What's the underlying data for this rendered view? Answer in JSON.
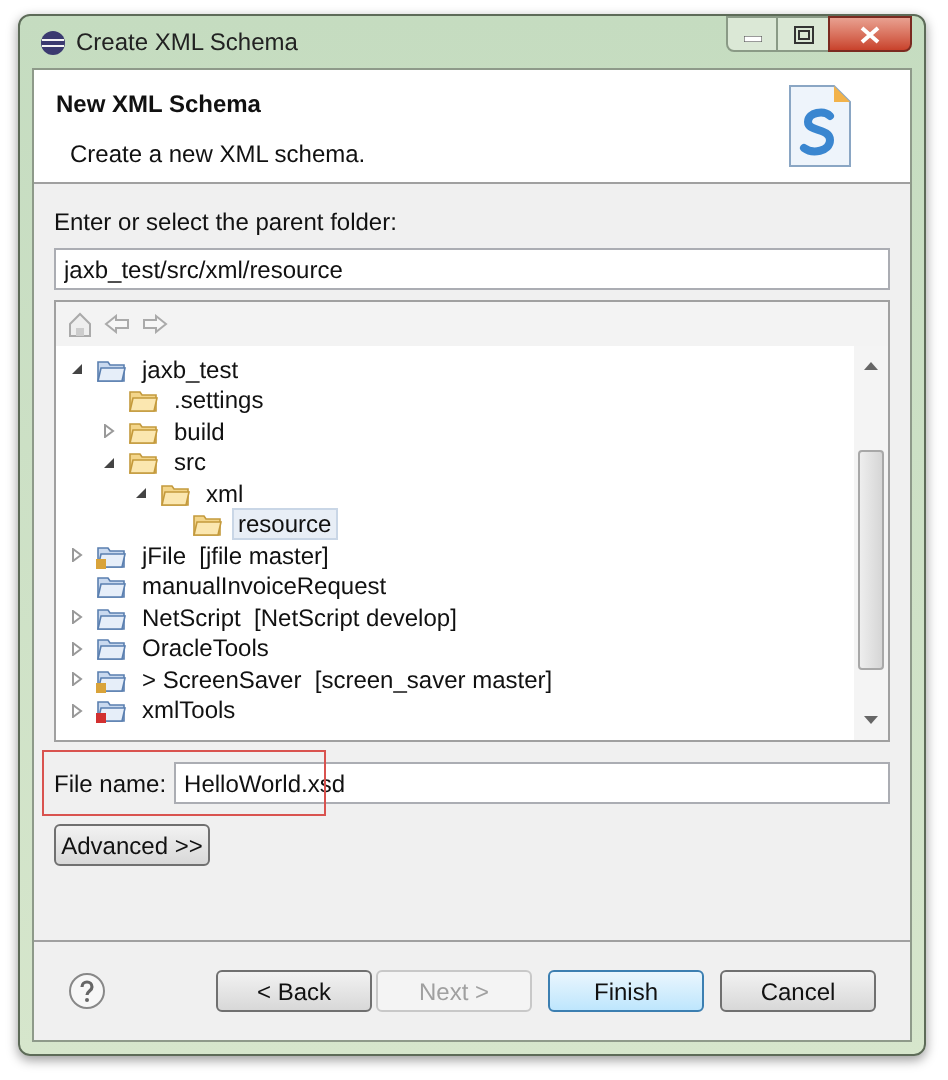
{
  "window": {
    "title": "Create XML Schema"
  },
  "header": {
    "title": "New XML Schema",
    "description": "Create a new XML schema."
  },
  "parent_folder": {
    "label": "Enter or select the parent folder:",
    "value": "jaxb_test/src/xml/resource"
  },
  "tree": [
    {
      "label": "jaxb_test",
      "kind": "project",
      "expanded": true,
      "selected": false,
      "children": [
        {
          "label": ".settings",
          "kind": "folder",
          "selected": false
        },
        {
          "label": "build",
          "kind": "folder",
          "expanded": false,
          "selected": false
        },
        {
          "label": "src",
          "kind": "folder",
          "expanded": true,
          "selected": false,
          "children": [
            {
              "label": "xml",
              "kind": "folder",
              "expanded": true,
              "selected": false,
              "children": [
                {
                  "label": "resource",
                  "kind": "folder",
                  "selected": true
                }
              ]
            }
          ]
        }
      ]
    },
    {
      "label": "jFile  [jfile master]",
      "kind": "git-project",
      "expanded": false,
      "selected": false
    },
    {
      "label": "manualInvoiceRequest",
      "kind": "project",
      "selected": false
    },
    {
      "label": "NetScript  [NetScript develop]",
      "kind": "project",
      "expanded": false,
      "selected": false
    },
    {
      "label": "OracleTools",
      "kind": "project",
      "expanded": false,
      "selected": false
    },
    {
      "label": "> ScreenSaver  [screen_saver master]",
      "kind": "git-project",
      "expanded": false,
      "selected": false
    },
    {
      "label": "xmlTools",
      "kind": "error-project",
      "expanded": false,
      "selected": false
    }
  ],
  "file_name": {
    "label": "File name:",
    "value": "HelloWorld.xsd"
  },
  "advanced_button": "Advanced >>",
  "buttons": [
    {
      "label": "< Back",
      "disabled": false,
      "default": false
    },
    {
      "label": "Next >",
      "disabled": true,
      "default": false
    },
    {
      "label": "Finish",
      "disabled": false,
      "default": true
    },
    {
      "label": "Cancel",
      "disabled": false,
      "default": false
    }
  ]
}
